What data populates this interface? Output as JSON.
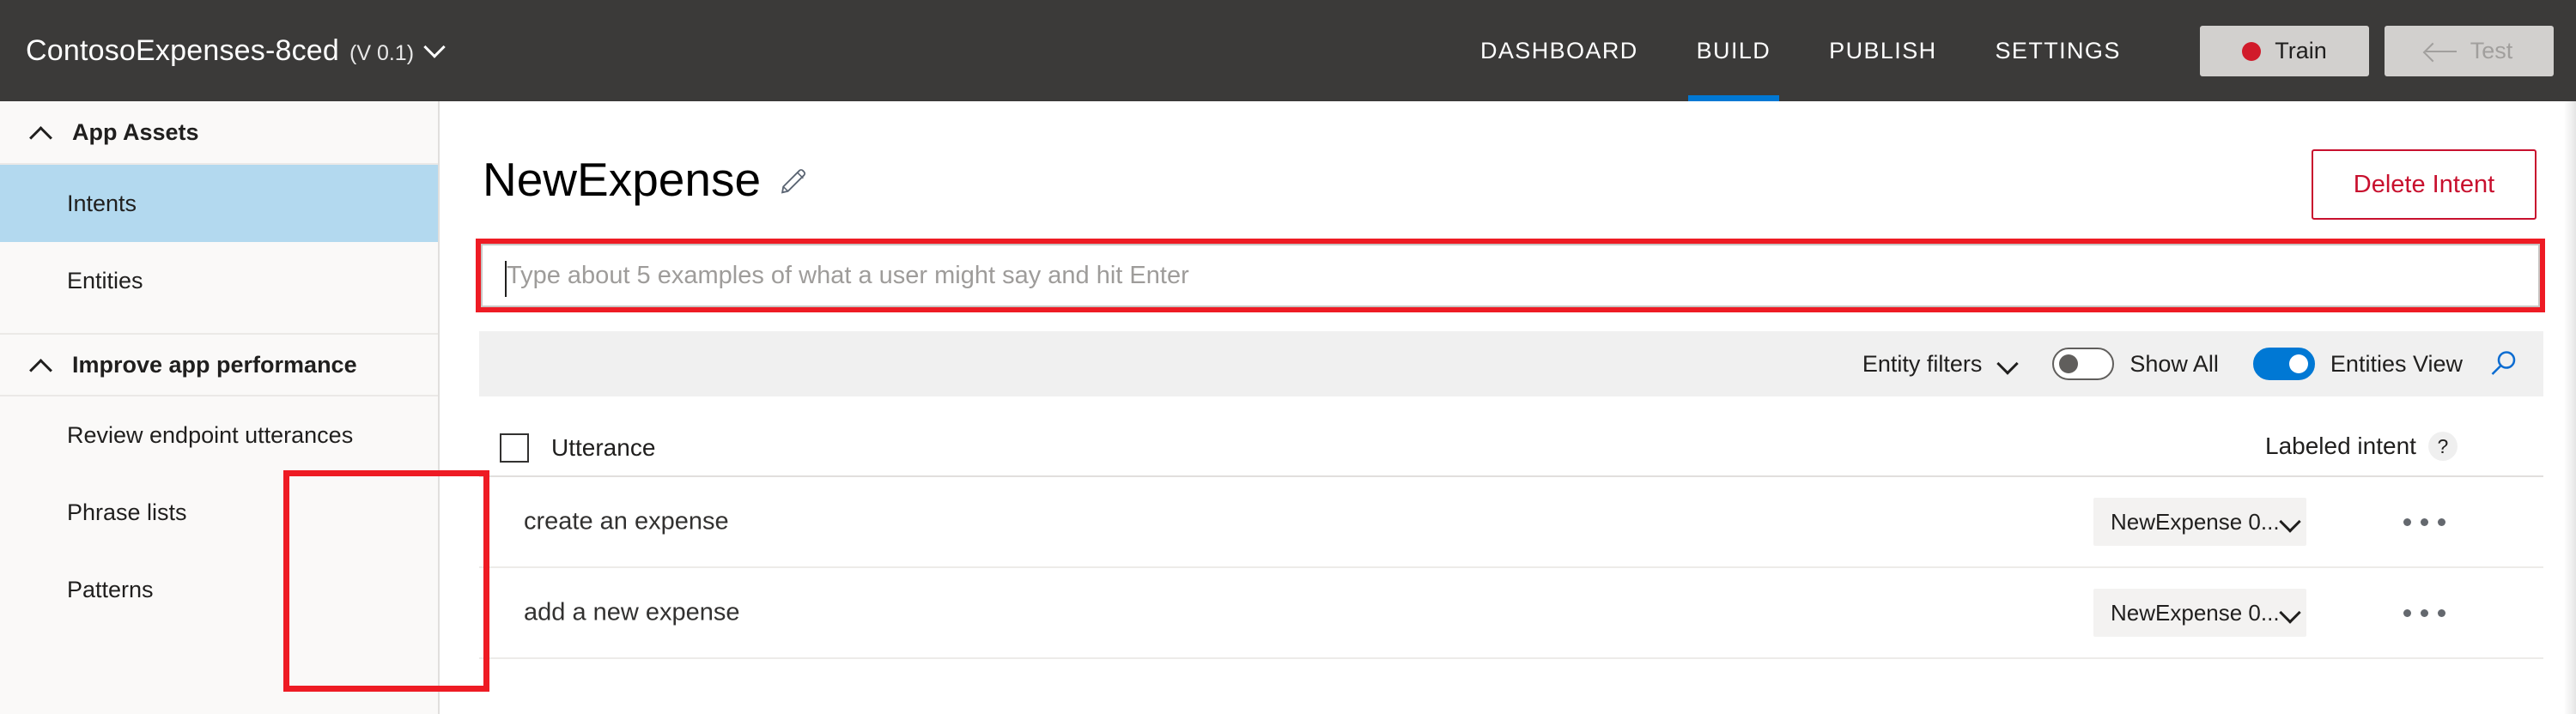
{
  "topbar": {
    "app_name": "ContosoExpenses-8ced",
    "app_version": "(V 0.1)",
    "nav": [
      {
        "label": "DASHBOARD",
        "active": false
      },
      {
        "label": "BUILD",
        "active": true
      },
      {
        "label": "PUBLISH",
        "active": false
      },
      {
        "label": "SETTINGS",
        "active": false
      }
    ],
    "train_label": "Train",
    "test_label": "Test",
    "accent_color": "#0078d4",
    "train_dot_color": "#d11a2a",
    "bar_color": "#3b3a39"
  },
  "sidebar": {
    "groups": [
      {
        "header": "App Assets",
        "items": [
          {
            "label": "Intents",
            "selected": true
          },
          {
            "label": "Entities",
            "selected": false
          }
        ]
      },
      {
        "header": "Improve app performance",
        "items": [
          {
            "label": "Review endpoint utterances",
            "selected": false
          },
          {
            "label": "Phrase lists",
            "selected": false
          },
          {
            "label": "Patterns",
            "selected": false
          }
        ]
      }
    ],
    "selected_bg": "#b3d9ef"
  },
  "main": {
    "page_title": "NewExpense",
    "delete_button": "Delete Intent",
    "utterance_input": {
      "value": "",
      "placeholder": "Type about 5 examples of what a user might say and hit Enter",
      "highlight_color": "#ee1b24"
    },
    "toolbar": {
      "entity_filters_label": "Entity filters",
      "show_all_label": "Show All",
      "show_all_on": false,
      "entities_view_label": "Entities View",
      "entities_view_on": true,
      "toggle_on_color": "#0078d4",
      "search_icon_color": "#0c6cd1"
    },
    "table": {
      "col_utterance": "Utterance",
      "col_labeled_intent": "Labeled intent",
      "help_glyph": "?",
      "rows": [
        {
          "utterance": "create an expense",
          "labeled_intent": "NewExpense 0..."
        },
        {
          "utterance": "add a new expense",
          "labeled_intent": "NewExpense 0..."
        }
      ]
    }
  }
}
